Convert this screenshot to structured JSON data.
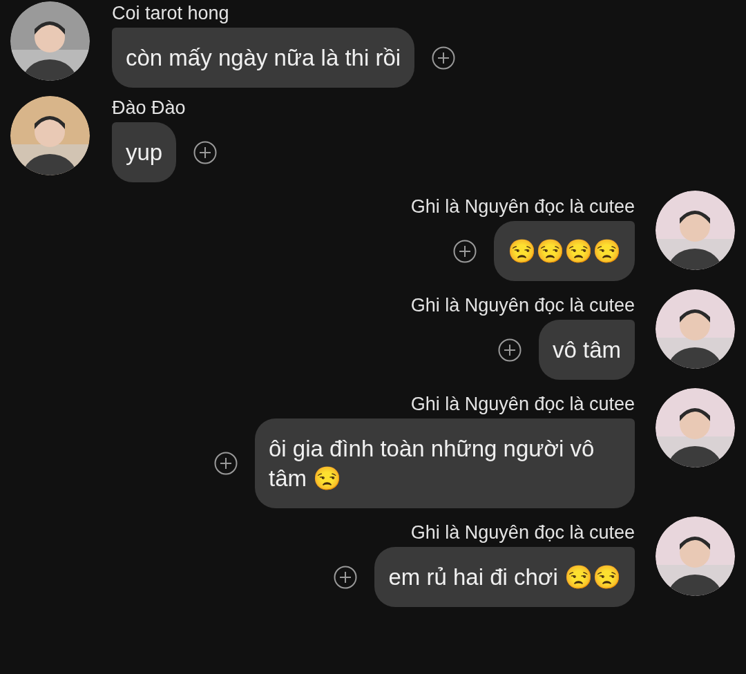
{
  "messages": [
    {
      "kind": "received",
      "sender": "Coi tarot hong",
      "text": "còn mấy ngày nữa là thi rồi"
    },
    {
      "kind": "received",
      "sender": "Đào Đào",
      "text": "yup"
    },
    {
      "kind": "sent",
      "sender": "Ghi là Nguyên đọc là cutee",
      "text": "😒😒😒😒"
    },
    {
      "kind": "sent",
      "sender": "Ghi là Nguyên đọc là cutee",
      "text": "vô tâm"
    },
    {
      "kind": "sent",
      "sender": "Ghi là Nguyên đọc là cutee",
      "text": "ôi gia đình toàn những người vô tâm 😒"
    },
    {
      "kind": "sent",
      "sender": "Ghi là Nguyên đọc là cutee",
      "text": "em rủ hai đi chơi 😒😒"
    }
  ]
}
